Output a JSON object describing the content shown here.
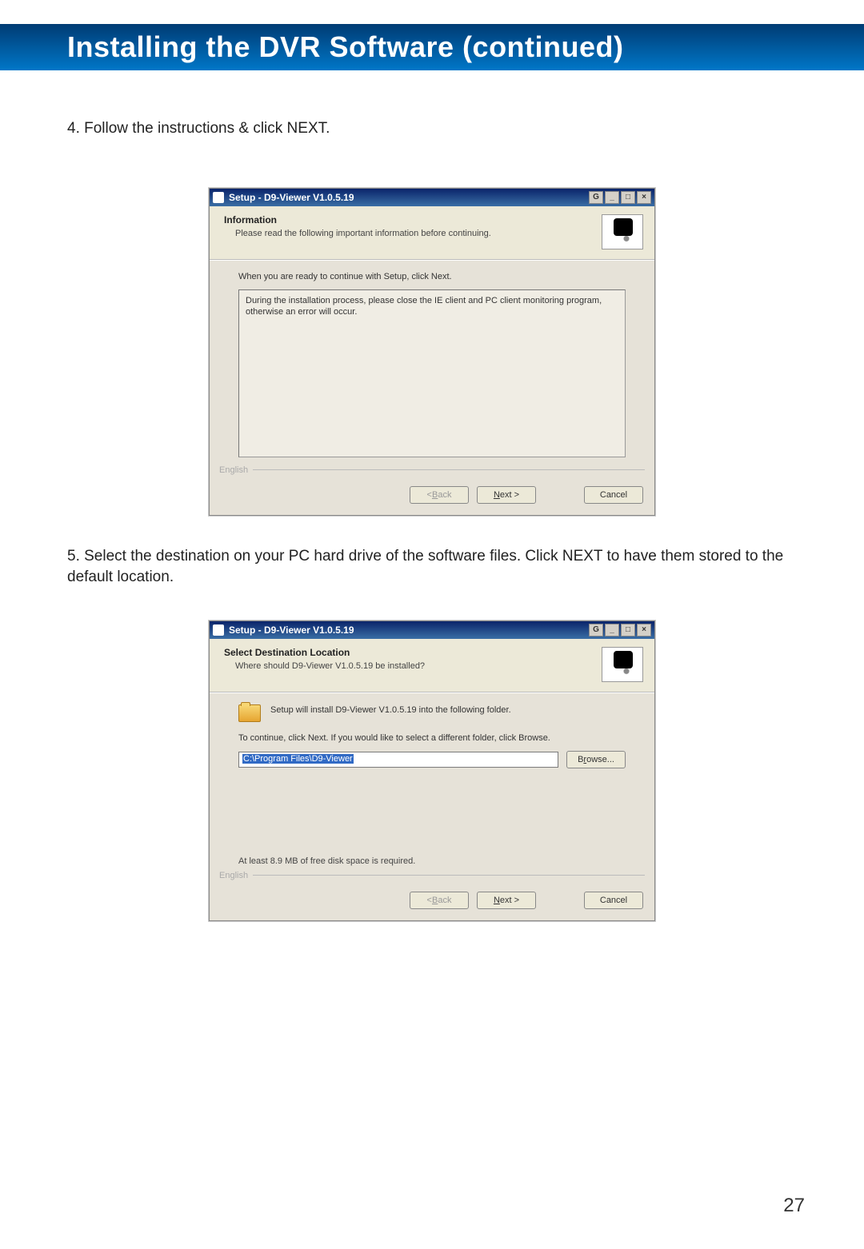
{
  "header": {
    "title": "Installing the DVR Software (continued)"
  },
  "step4": {
    "text": "4. Follow the instructions & click NEXT."
  },
  "dialog1": {
    "title": "Setup - D9-Viewer V1.0.5.19",
    "header_title": "Information",
    "header_sub": "Please read the following important information before continuing.",
    "prompt": "When you are ready to continue with Setup, click Next.",
    "info_text": "During the installation process, please close the IE client and PC client monitoring program, otherwise an error will occur.",
    "lang": "English",
    "back": "< Back",
    "next": "Next >",
    "cancel": "Cancel"
  },
  "step5": {
    "text": "5. Select the destination on your PC hard drive of the software files. Click NEXT to have them stored to the default location."
  },
  "dialog2": {
    "title": "Setup - D9-Viewer V1.0.5.19",
    "header_title": "Select Destination Location",
    "header_sub": "Where should D9-Viewer V1.0.5.19 be installed?",
    "install_line": "Setup will install D9-Viewer V1.0.5.19 into the following folder.",
    "continue_line": "To continue, click Next. If you would like to select a different folder, click Browse.",
    "path": "C:\\Program Files\\D9-Viewer",
    "browse": "Browse...",
    "disk_req": "At least 8.9 MB of free disk space is required.",
    "lang": "English",
    "back": "< Back",
    "next": "Next >",
    "cancel": "Cancel"
  },
  "page_number": "27"
}
